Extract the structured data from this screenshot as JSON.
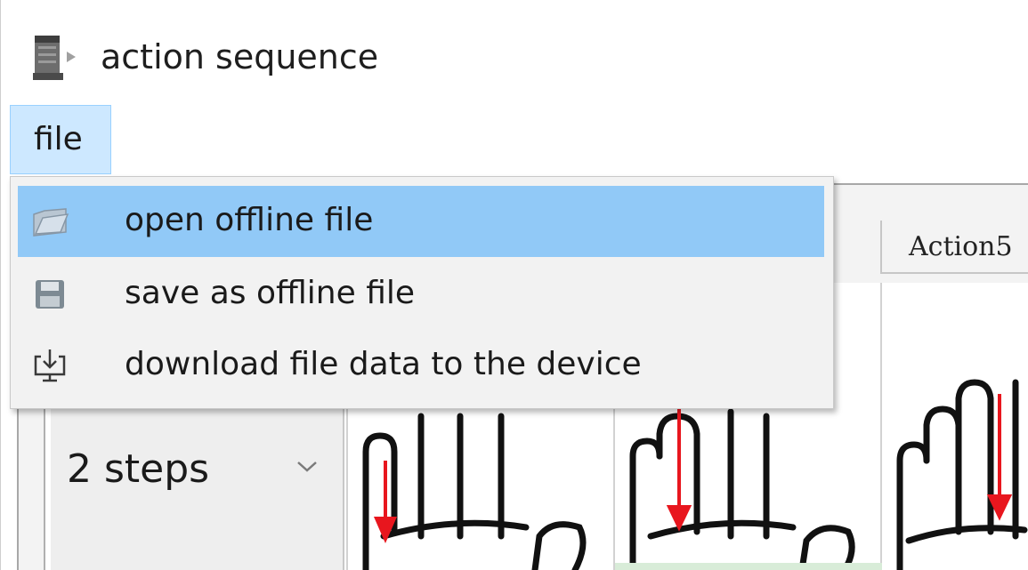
{
  "window": {
    "title": "action sequence",
    "app_icon": "app-window-icon"
  },
  "menubar": {
    "file_label": "file"
  },
  "file_menu": {
    "items": [
      {
        "label": "open offline file",
        "icon": "folder-open-icon",
        "highlighted": true
      },
      {
        "label": "save as offline file",
        "icon": "floppy-disk-icon",
        "highlighted": false
      },
      {
        "label": "download file data to the device",
        "icon": "download-to-monitor-icon",
        "highlighted": false
      }
    ]
  },
  "table": {
    "visible_header": "Action5",
    "row": {
      "steps_value": "2 steps"
    }
  },
  "colors": {
    "menu_highlight": "#91c9f7",
    "menu_file_active": "#cde8ff",
    "arrow_red": "#e8161e"
  }
}
